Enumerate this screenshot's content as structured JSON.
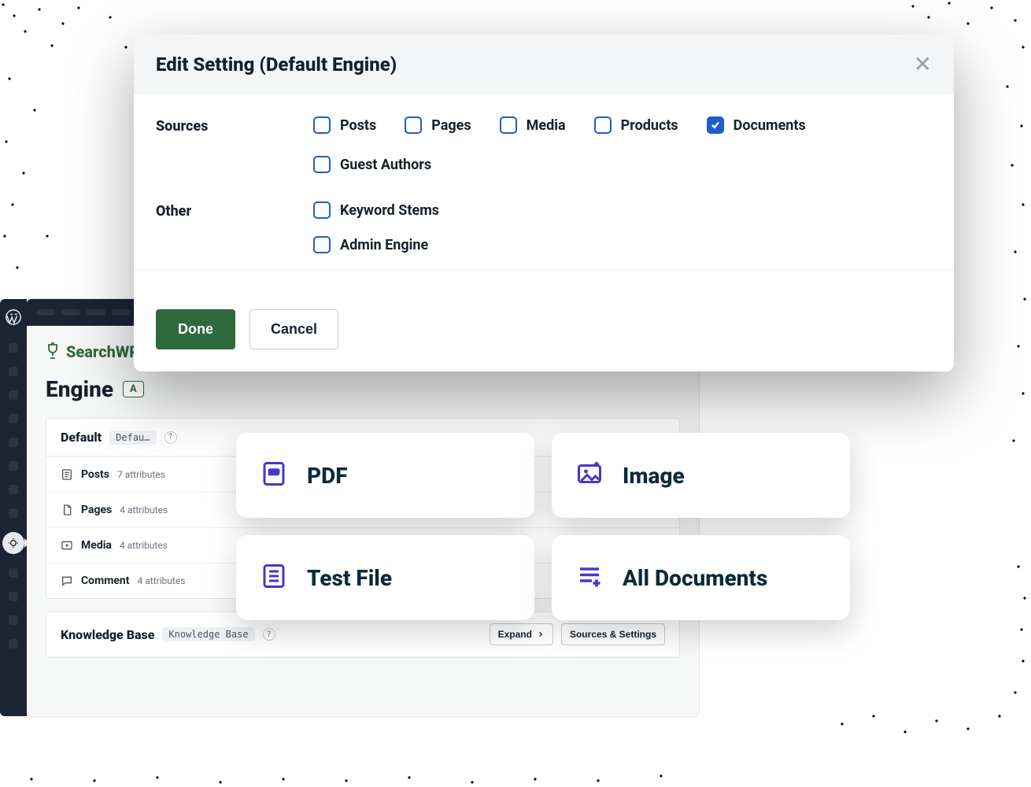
{
  "background_app": {
    "brand": "SearchWP",
    "main_heading": "Engine",
    "add_button_label": "A",
    "panels": [
      {
        "title": "Default",
        "subtitle": "Defau…",
        "rows": [
          {
            "icon": "post",
            "name": "Posts",
            "meta": "7 attributes"
          },
          {
            "icon": "page",
            "name": "Pages",
            "meta": "4 attributes"
          },
          {
            "icon": "media",
            "name": "Media",
            "meta": "4 attributes"
          },
          {
            "icon": "comment",
            "name": "Comment",
            "meta": "4 attributes"
          }
        ]
      },
      {
        "title": "Knowledge Base",
        "subtitle": "Knowledge Base",
        "actions": {
          "expand": "Expand",
          "sources": "Sources & Settings"
        }
      }
    ]
  },
  "modal": {
    "title": "Edit Setting (Default Engine)",
    "sections": {
      "sources": {
        "label": "Sources",
        "options": [
          {
            "key": "posts",
            "label": "Posts",
            "checked": false
          },
          {
            "key": "pages",
            "label": "Pages",
            "checked": false
          },
          {
            "key": "media",
            "label": "Media",
            "checked": false
          },
          {
            "key": "products",
            "label": "Products",
            "checked": false
          },
          {
            "key": "documents",
            "label": "Documents",
            "checked": true
          },
          {
            "key": "guest_authors",
            "label": "Guest Authors",
            "checked": false
          }
        ]
      },
      "other": {
        "label": "Other",
        "options": [
          {
            "key": "keyword_stems",
            "label": "Keyword Stems",
            "checked": false
          },
          {
            "key": "admin_engine",
            "label": "Admin Engine",
            "checked": false
          }
        ]
      }
    },
    "buttons": {
      "primary": "Done",
      "secondary": "Cancel"
    }
  },
  "tiles": [
    {
      "icon": "pdf",
      "label": "PDF"
    },
    {
      "icon": "image",
      "label": "Image"
    },
    {
      "icon": "testfile",
      "label": "Test File"
    },
    {
      "icon": "alldocs",
      "label": "All Documents"
    }
  ]
}
